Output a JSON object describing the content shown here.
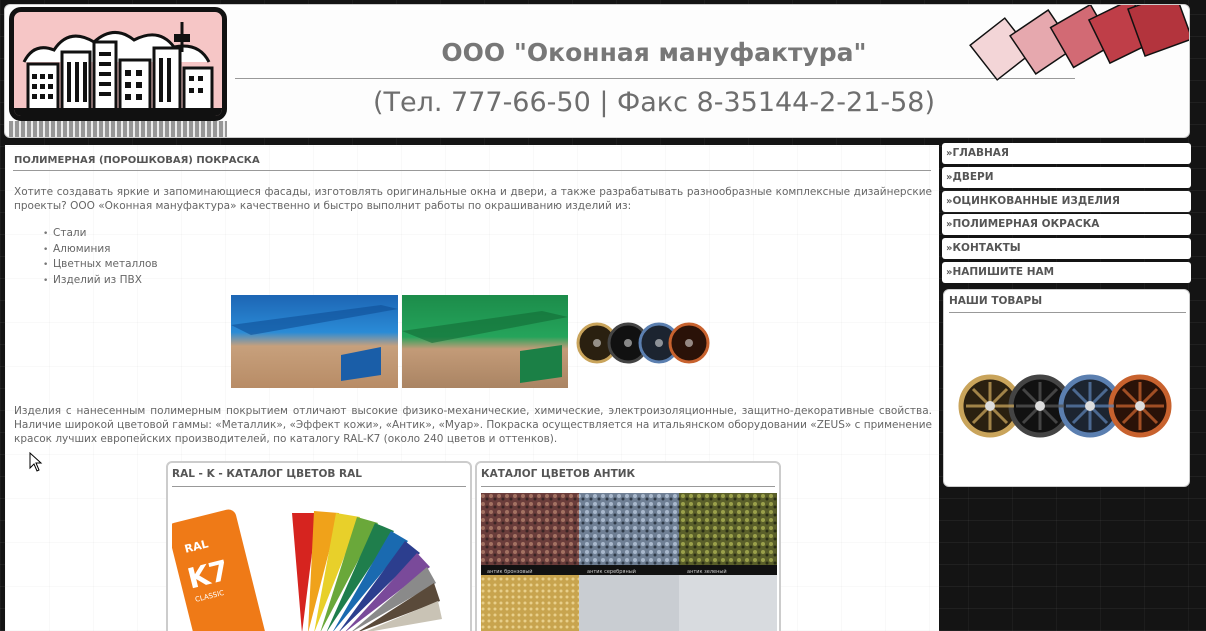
{
  "header": {
    "company": "ООО \"Оконная мануфактура\"",
    "contacts": "(Тел. 777-66-50 | Факс 8-35144-2-21-58)"
  },
  "main": {
    "title": "ПОЛИМЕРНАЯ (ПОРОШКОВАЯ) ПОКРАСКА",
    "intro": "Хотите создавать яркие и запоминающиеся фасады, изготовлять оригинальные окна и двери, а также разрабатывать разнообразные комплексные дизайнерские проекты? ООО «Оконная мануфактура» качественно и быстро выполнит работы по окрашиванию изделий из:",
    "materials": [
      "Стали",
      "Алюминия",
      "Цветных металлов",
      "Изделий из ПВХ"
    ],
    "description": "Изделия с нанесенным полимерным покрытием отличают высокие физико-механические, химические, электроизоляционные, защитно-декоративные свойства. Наличие широкой цветовой гаммы: «Металлик», «Эффект кожи», «Антик», «Муар». Покраска осуществляется на итальянском оборудовании «ZEUS» с применение красок лучших европейских производителей, по каталогу RAL-K7 (около 240 цветов и оттенков).",
    "cards": [
      {
        "title": "RAL - K - КАТАЛОГ ЦВЕТОВ RAL",
        "badge_top": "RAL",
        "badge_main": "K7",
        "badge_sub": "CLASSIC"
      },
      {
        "title": "КАТАЛОГ ЦВЕТОВ АНТИК",
        "swatch_labels": [
          "антик бронзовый",
          "антик серебряный",
          "антик зеленый"
        ]
      }
    ]
  },
  "menu": {
    "arrow": "»",
    "items": [
      "ГЛАВНАЯ",
      "ДВЕРИ",
      "ОЦИНКОВАННЫЕ ИЗДЕЛИЯ",
      "ПОЛИМЕРНАЯ ОКРАСКА",
      "КОНТАКТЫ",
      "НАПИШИТЕ НАМ"
    ]
  },
  "sidebar": {
    "goods_title": "НАШИ ТОВАРЫ"
  },
  "icons": {
    "logo": "city-skyline-logo",
    "decoration": "rotated-squares-icon",
    "cursor": "mouse-pointer-icon"
  },
  "colors": {
    "background": "#141414",
    "text": "#666666",
    "heading": "#555555",
    "logo_bg": "#f6c6c6",
    "deco_red": "#b3343d"
  }
}
